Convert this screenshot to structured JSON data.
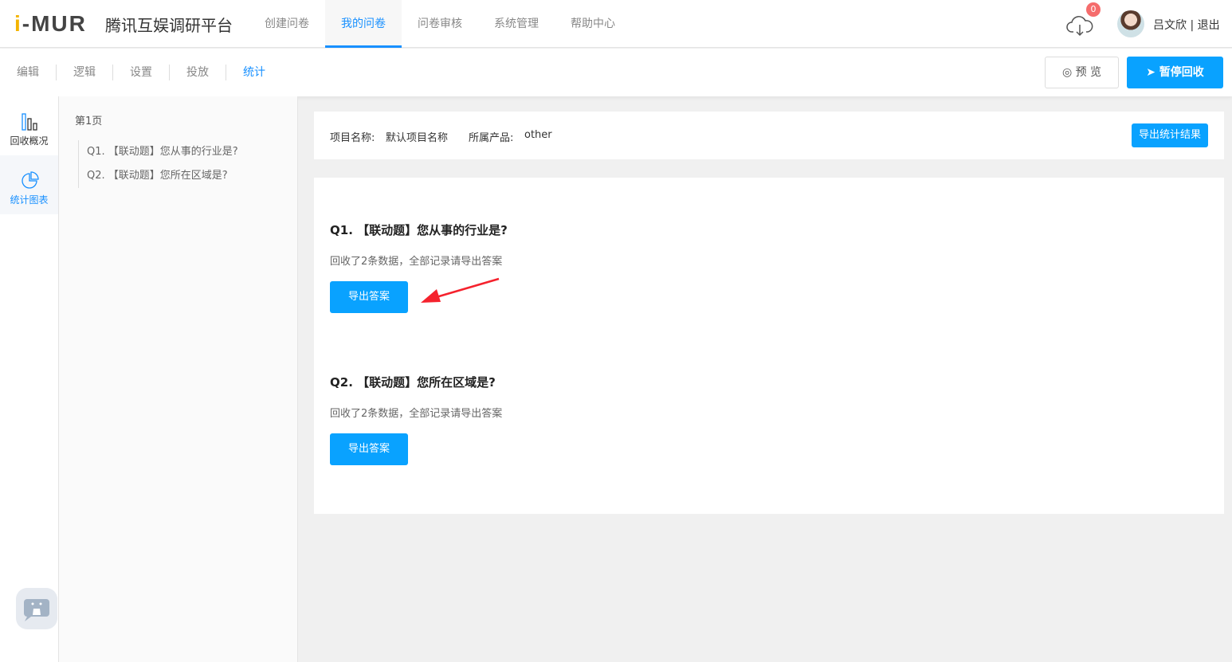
{
  "header": {
    "logo": "i-MUR",
    "brand": "腾讯互娱调研平台",
    "nav": [
      "创建问卷",
      "我的问卷",
      "问卷审核",
      "系统管理",
      "帮助中心"
    ],
    "active_nav": 1,
    "badge": "0",
    "user": "吕文欣",
    "logout": "| 退出"
  },
  "toolbar": {
    "tabs": [
      "编辑",
      "逻辑",
      "设置",
      "投放",
      "统计"
    ],
    "active_tab": 4,
    "preview": "预 览",
    "pause": "暂停回收"
  },
  "rail": [
    {
      "label": "回收概况",
      "icon": "bar-chart-icon"
    },
    {
      "label": "统计图表",
      "icon": "pie-chart-icon",
      "active": true
    }
  ],
  "qlist": {
    "page": "第1页",
    "items": [
      "Q1. 【联动题】您从事的行业是?",
      "Q2. 【联动题】您所在区域是?"
    ]
  },
  "info": {
    "project_label": "项目名称:",
    "project": "默认项目名称",
    "product_label": "所属产品:",
    "product": "other",
    "export_all": "导出统计结果"
  },
  "questions": [
    {
      "title": "Q1. 【联动题】您从事的行业是?",
      "desc": "回收了2条数据，全部记录请导出答案",
      "button": "导出答案"
    },
    {
      "title": "Q2. 【联动题】您所在区域是?",
      "desc": "回收了2条数据，全部记录请导出答案",
      "button": "导出答案"
    }
  ],
  "colors": {
    "accent": "#09a2ff",
    "link": "#1890ff",
    "badge": "#f56c6c",
    "arrow": "#f5222d"
  }
}
